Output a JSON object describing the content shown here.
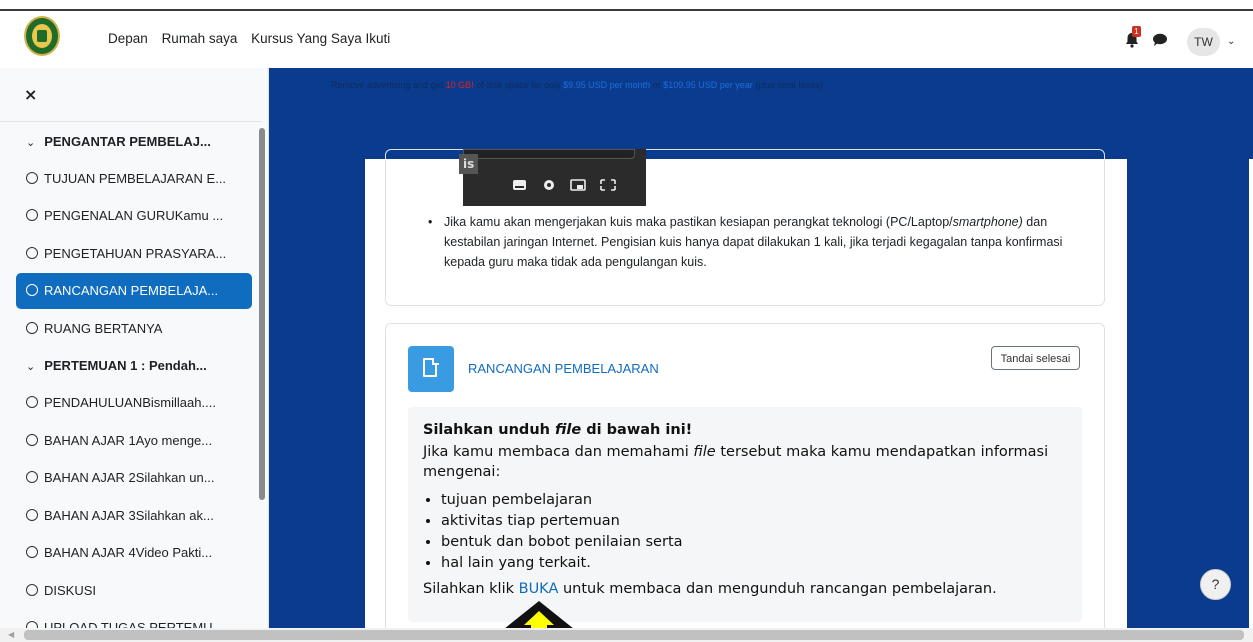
{
  "navbar": {
    "links": [
      "Depan",
      "Rumah saya",
      "Kursus Yang Saya Ikuti"
    ],
    "notification_count": "1",
    "avatar_initials": "TW"
  },
  "sidebar": {
    "close_label": "×",
    "items": [
      {
        "label": "PENGANTAR PEMBELAJ...",
        "type": "section"
      },
      {
        "label": "TUJUAN PEMBELAJARAN E...",
        "type": "item"
      },
      {
        "label": "PENGENALAN GURUKamu ...",
        "type": "item"
      },
      {
        "label": "PENGETAHUAN PRASYARA...",
        "type": "item"
      },
      {
        "label": "RANCANGAN PEMBELAJA...",
        "type": "item",
        "active": true
      },
      {
        "label": "RUANG BERTANYA",
        "type": "item"
      },
      {
        "label": "PERTEMUAN 1 : Pendah...",
        "type": "section"
      },
      {
        "label": "PENDAHULUANBismillaah....",
        "type": "item"
      },
      {
        "label": "BAHAN AJAR 1Ayo menge...",
        "type": "item"
      },
      {
        "label": "BAHAN AJAR 2Silahkan un...",
        "type": "item"
      },
      {
        "label": "BAHAN AJAR 3Silahkan ak...",
        "type": "item"
      },
      {
        "label": "BAHAN AJAR 4Video Pakti...",
        "type": "item"
      },
      {
        "label": "DISKUSI",
        "type": "item"
      },
      {
        "label": "UPLOAD TUGAS PERTEMU...",
        "type": "item"
      }
    ]
  },
  "ad": {
    "part1": "Remove advertising and get ",
    "highlight": "10 GB!",
    "part2": " of disk space for only ",
    "price_month": "$9.95 USD per month",
    "or": " or ",
    "price_year": "$109.95 USD per year",
    "part3": " (plus local taxes)"
  },
  "video": {
    "label": "is"
  },
  "bullet": {
    "text_before": "Jika kamu akan mengerjakan kuis maka pastikan kesiapan perangkat teknologi (PC/Laptop/",
    "text_italic": "smartphone)",
    "text_after": " dan kestabilan jaringan Internet. Pengisian kuis hanya dapat dilakukan 1 kali, jika terjadi kegagalan tanpa konfirmasi kepada guru maka tidak ada pengulangan kuis."
  },
  "activity": {
    "title": "RANCANGAN PEMBELAJARAN",
    "done_button": "Tandai selesai",
    "heading_before": "Silahkan unduh ",
    "heading_italic": "file",
    "heading_after": " di bawah ini!",
    "intro_before": "Jika kamu membaca dan memahami ",
    "intro_italic": "file",
    "intro_after": " tersebut maka kamu mendapatkan informasi mengenai:",
    "list": [
      "tujuan pembelajaran",
      "aktivitas tiap pertemuan",
      "bentuk dan bobot penilaian serta",
      "hal lain yang terkait."
    ],
    "cta_before": "Silahkan klik ",
    "cta_link": "BUKA",
    "cta_after": " untuk membaca dan mengunduh rancangan pembelajaran."
  },
  "help_label": "?",
  "colors": {
    "brand_blue": "#0f6cbf",
    "ad_background": "#0b3b8c",
    "arrow_fill": "#ffff00",
    "badge_red": "#ca3120"
  }
}
